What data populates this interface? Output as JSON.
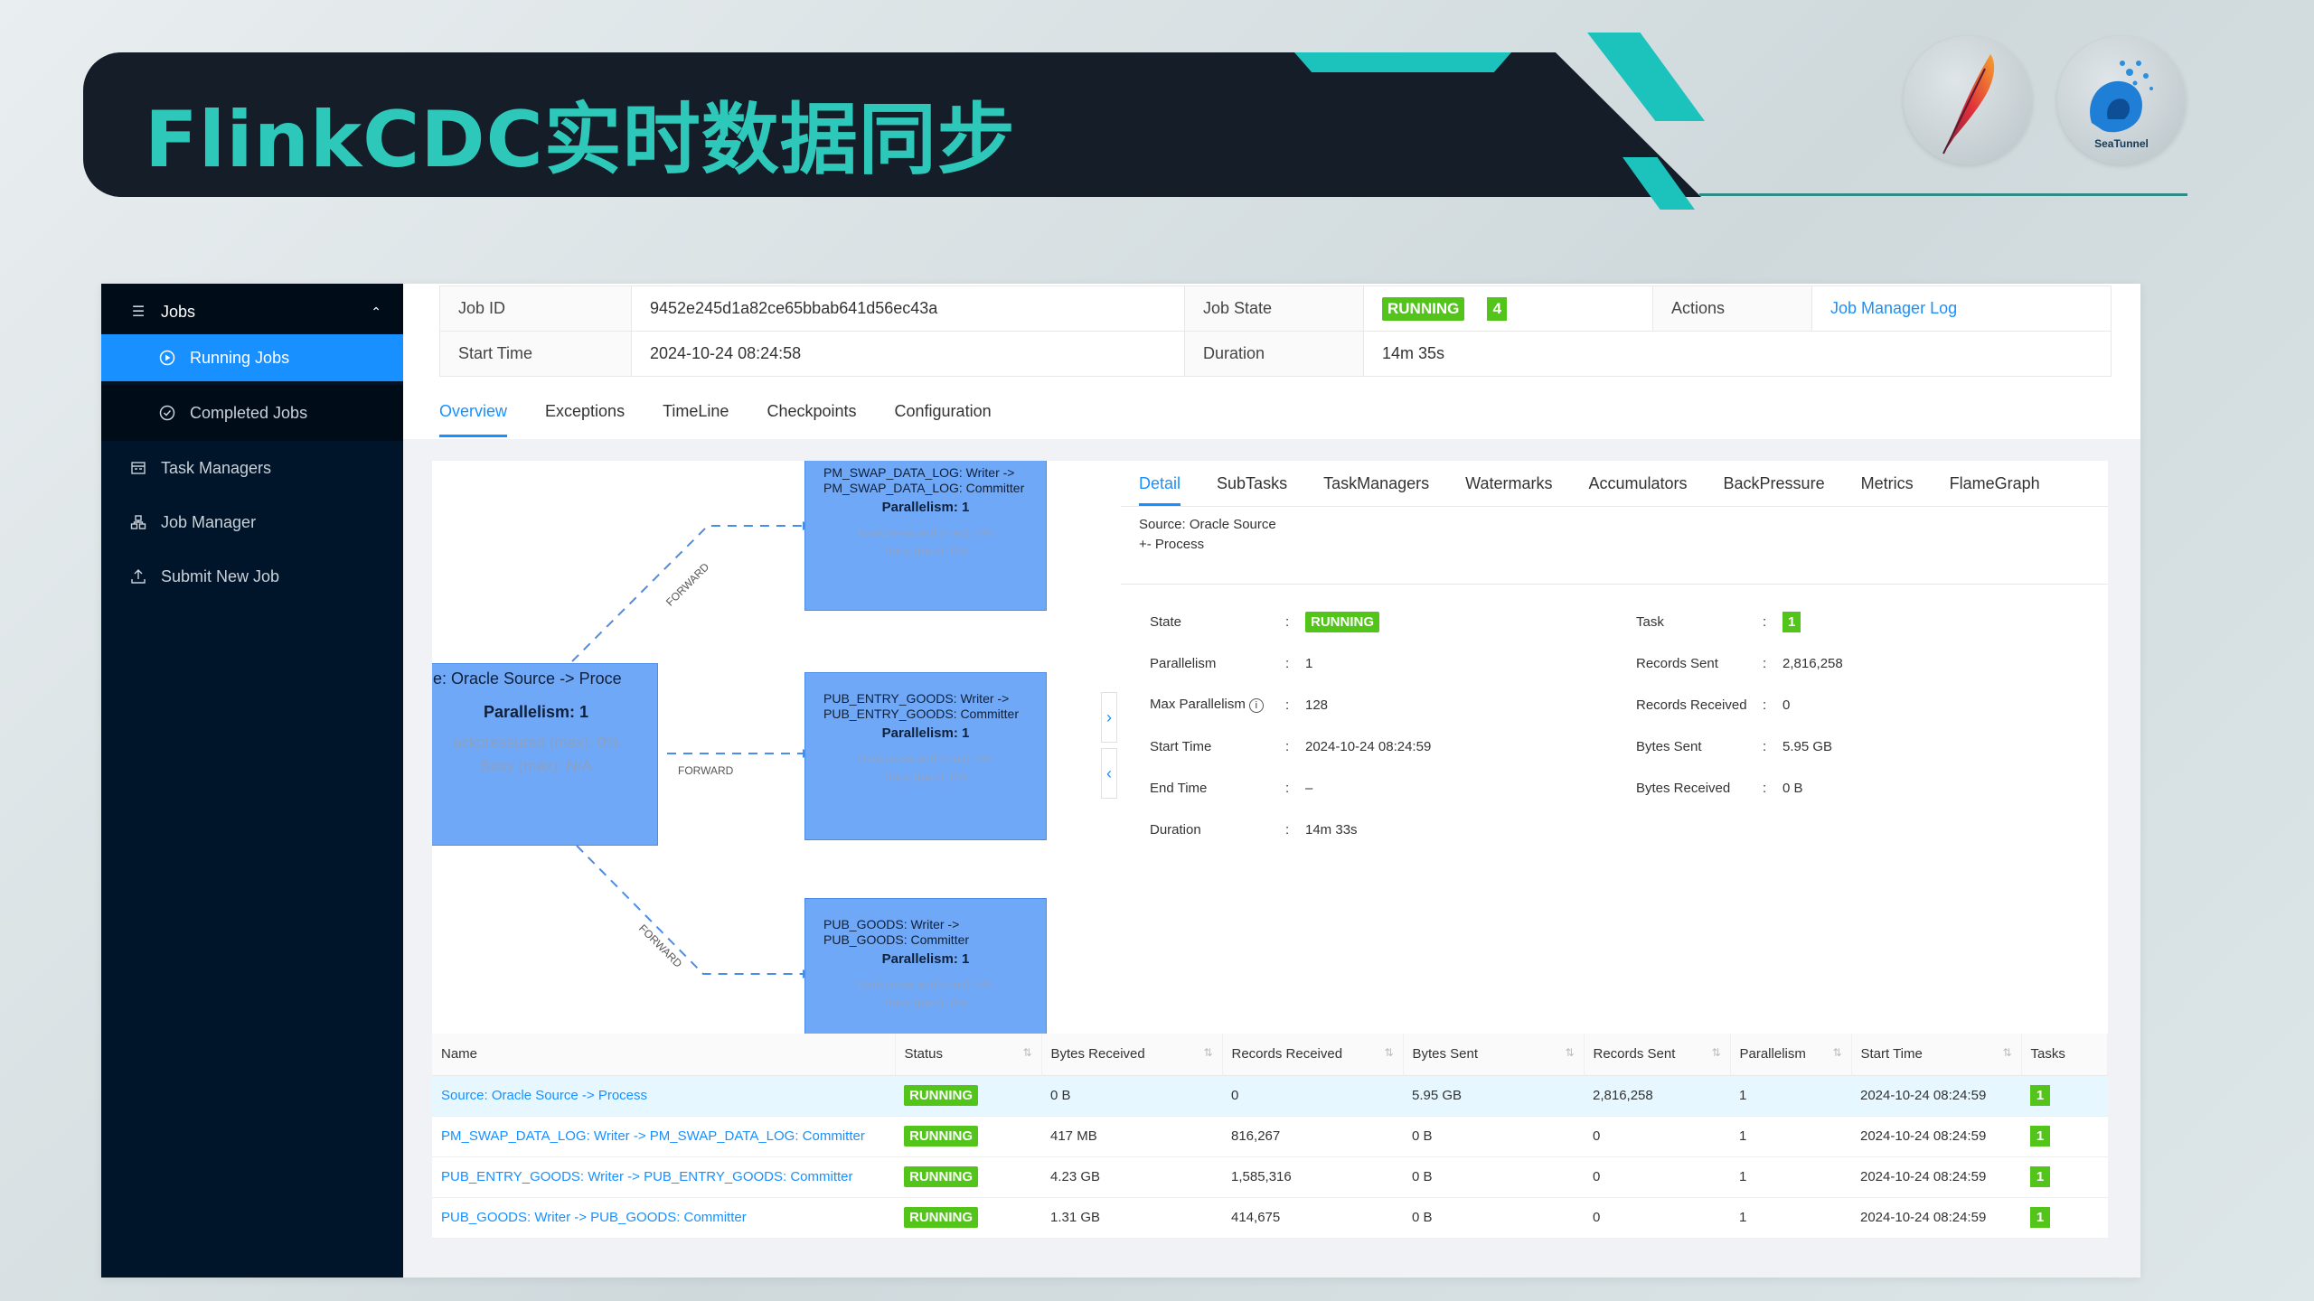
{
  "slide": {
    "title": "FlinkCDC实时数据同步",
    "logos": {
      "apache": "apache-feather-logo",
      "seatunnel_label": "SeaTunnel"
    }
  },
  "sidebar": {
    "group": {
      "label": "Jobs",
      "icon": "list-icon"
    },
    "sub_items": [
      {
        "label": "Running Jobs",
        "icon": "play-circle-icon",
        "active": true
      },
      {
        "label": "Completed Jobs",
        "icon": "check-circle-icon",
        "active": false
      }
    ],
    "items": [
      {
        "label": "Task Managers",
        "icon": "schedule-icon"
      },
      {
        "label": "Job Manager",
        "icon": "cluster-icon"
      },
      {
        "label": "Submit New Job",
        "icon": "upload-icon"
      }
    ]
  },
  "job": {
    "id_label": "Job ID",
    "id": "9452e245d1a82ce65bbab641d56ec43a",
    "state_label": "Job State",
    "state": "RUNNING",
    "state_count": "4",
    "actions_label": "Actions",
    "action_link": "Job Manager Log",
    "start_label": "Start Time",
    "start": "2024-10-24 08:24:58",
    "duration_label": "Duration",
    "duration": "14m 35s"
  },
  "tabs": [
    "Overview",
    "Exceptions",
    "TimeLine",
    "Checkpoints",
    "Configuration"
  ],
  "graph": {
    "main_node": {
      "name": "e: Oracle Source -> Proce",
      "parallelism": "Parallelism: 1",
      "backpressure": "ackpressured (max): 0%",
      "busy": "Busy (max): N/A"
    },
    "nodes": [
      {
        "name": "PM_SWAP_DATA_LOG: Writer -> PM_SWAP_DATA_LOG: Committer",
        "parallelism": "Parallelism: 1",
        "backpressure": "Backpressured (max): 0%",
        "busy": "Busy (max): 0%"
      },
      {
        "name": "PUB_ENTRY_GOODS: Writer -> PUB_ENTRY_GOODS: Committer",
        "parallelism": "Parallelism: 1",
        "backpressure": "Backpressured (max): 0%",
        "busy": "Busy (max): 0%"
      },
      {
        "name": "PUB_GOODS: Writer -> PUB_GOODS: Committer",
        "parallelism": "Parallelism: 1",
        "backpressure": "Backpressured (max): 0%",
        "busy": "Busy (max): 0%"
      }
    ],
    "edge_label": "FORWARD"
  },
  "detail": {
    "tabs": [
      "Detail",
      "SubTasks",
      "TaskManagers",
      "Watermarks",
      "Accumulators",
      "BackPressure",
      "Metrics",
      "FlameGraph"
    ],
    "desc_line1": "Source: Oracle Source",
    "desc_line2": "+- Process",
    "left": [
      {
        "k": "State",
        "v": "RUNNING",
        "badge": true
      },
      {
        "k": "Parallelism",
        "v": "1"
      },
      {
        "k": "Max Parallelism",
        "v": "128",
        "info": true
      },
      {
        "k": "Start Time",
        "v": "2024-10-24 08:24:59"
      },
      {
        "k": "End Time",
        "v": "–"
      },
      {
        "k": "Duration",
        "v": "14m 33s"
      }
    ],
    "right": [
      {
        "k": "Task",
        "v": "1",
        "badge": true
      },
      {
        "k": "Records Sent",
        "v": "2,816,258"
      },
      {
        "k": "Records Received",
        "v": "0"
      },
      {
        "k": "Bytes Sent",
        "v": "5.95 GB"
      },
      {
        "k": "Bytes Received",
        "v": "0 B"
      }
    ]
  },
  "table": {
    "headers": [
      "Name",
      "Status",
      "Bytes Received",
      "Records Received",
      "Bytes Sent",
      "Records Sent",
      "Parallelism",
      "Start Time",
      "Tasks"
    ],
    "rows": [
      {
        "name": "Source: Oracle Source -> Process",
        "status": "RUNNING",
        "bytes_received": "0 B",
        "records_received": "0",
        "bytes_sent": "5.95 GB",
        "records_sent": "2,816,258",
        "parallelism": "1",
        "start": "2024-10-24 08:24:59",
        "tasks": "1"
      },
      {
        "name": "PM_SWAP_DATA_LOG: Writer -> PM_SWAP_DATA_LOG: Committer",
        "status": "RUNNING",
        "bytes_received": "417 MB",
        "records_received": "816,267",
        "bytes_sent": "0 B",
        "records_sent": "0",
        "parallelism": "1",
        "start": "2024-10-24 08:24:59",
        "tasks": "1"
      },
      {
        "name": "PUB_ENTRY_GOODS: Writer -> PUB_ENTRY_GOODS: Committer",
        "status": "RUNNING",
        "bytes_received": "4.23 GB",
        "records_received": "1,585,316",
        "bytes_sent": "0 B",
        "records_sent": "0",
        "parallelism": "1",
        "start": "2024-10-24 08:24:59",
        "tasks": "1"
      },
      {
        "name": "PUB_GOODS: Writer -> PUB_GOODS: Committer",
        "status": "RUNNING",
        "bytes_received": "1.31 GB",
        "records_received": "414,675",
        "bytes_sent": "0 B",
        "records_sent": "0",
        "parallelism": "1",
        "start": "2024-10-24 08:24:59",
        "tasks": "1"
      }
    ]
  }
}
